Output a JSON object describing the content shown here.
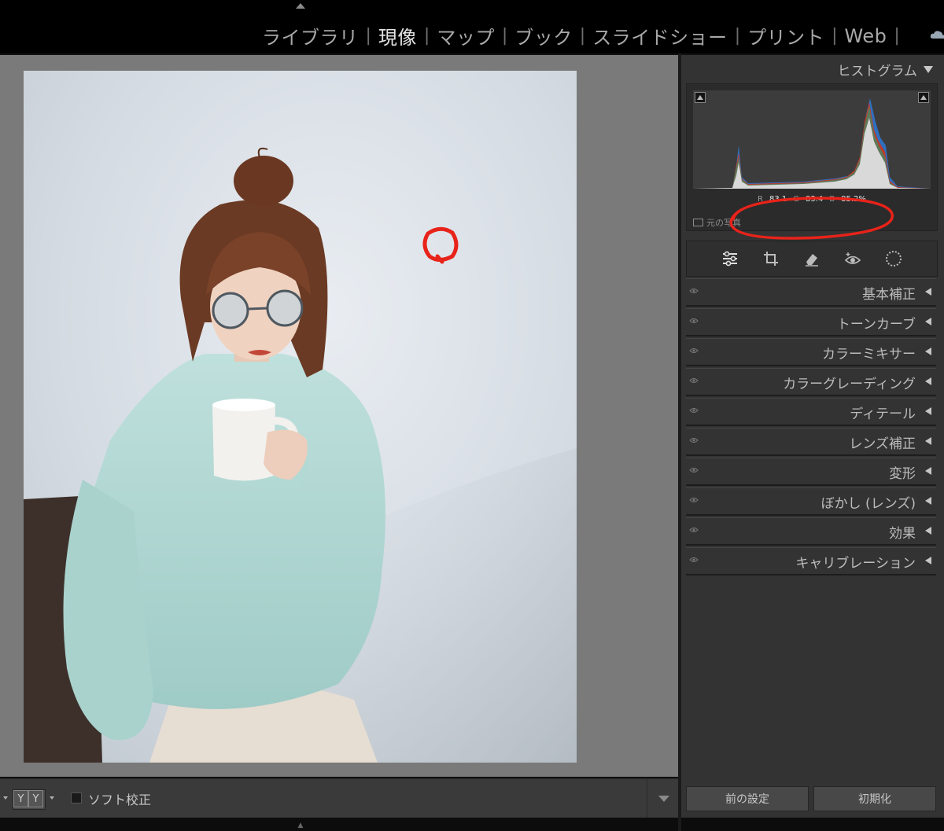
{
  "modules": {
    "items": [
      {
        "label": "ライブラリ",
        "active": false
      },
      {
        "label": "現像",
        "active": true
      },
      {
        "label": "マップ",
        "active": false
      },
      {
        "label": "ブック",
        "active": false
      },
      {
        "label": "スライドショー",
        "active": false
      },
      {
        "label": "プリント",
        "active": false
      },
      {
        "label": "Web",
        "active": false
      }
    ],
    "separator": "|"
  },
  "histogram": {
    "title": "ヒストグラム",
    "r_label": "R",
    "r_value": "83.1",
    "g_label": "G",
    "g_value": "83.4",
    "b_label": "B",
    "b_value": "85.2",
    "unit": "%",
    "original_label": "元の写真"
  },
  "tools": [
    "adjust-sliders-icon",
    "crop-icon",
    "healing-eraser-icon",
    "red-eye-icon",
    "mask-icon"
  ],
  "panels": [
    {
      "label": "基本補正"
    },
    {
      "label": "トーンカーブ"
    },
    {
      "label": "カラーミキサー"
    },
    {
      "label": "カラーグレーディング"
    },
    {
      "label": "ディテール"
    },
    {
      "label": "レンズ補正"
    },
    {
      "label": "変形"
    },
    {
      "label": "ぼかし (レンズ)"
    },
    {
      "label": "効果"
    },
    {
      "label": "キャリブレーション"
    }
  ],
  "toolbar": {
    "view_mode_label": "Y|Y",
    "view_left": "Y",
    "view_right": "Y",
    "soft_proof_label": "ソフト校正",
    "soft_proof_checked": false
  },
  "buttons": {
    "previous_label": "前の設定",
    "reset_label": "初期化"
  },
  "colors": {
    "annotation_red": "#e8231a",
    "active_module": "#e4e4e4",
    "inactive_module": "#a8a8a8"
  }
}
